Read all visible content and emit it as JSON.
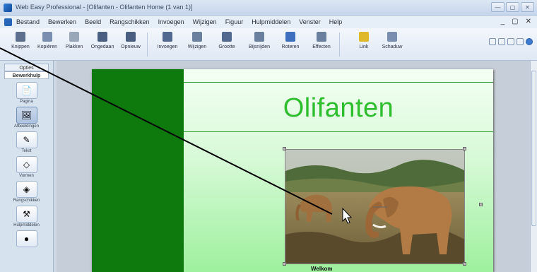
{
  "window": {
    "title": "Web Easy Professional - [Olifanten - Olifanten Home (1 van 1)]",
    "minimize": "—",
    "maximize": "▢",
    "close": "✕"
  },
  "menu": {
    "items": [
      "Bestand",
      "Bewerken",
      "Beeld",
      "Rangschikken",
      "Invoegen",
      "Wijzigen",
      "Figuur",
      "Hulpmiddelen",
      "Venster",
      "Help"
    ],
    "right": [
      "_",
      "▢",
      "✕"
    ]
  },
  "toolbar": {
    "buttons": [
      {
        "label": "Knippen",
        "color": "#5d6f8c"
      },
      {
        "label": "Kopiëren",
        "color": "#7a8fb0"
      },
      {
        "label": "Plakken",
        "color": "#9aa7b8"
      },
      {
        "label": "Ongedaan",
        "color": "#4a5e82"
      },
      {
        "label": "Opnieuw",
        "color": "#4a5e82"
      },
      {
        "label": "Invoegen",
        "color": "#52698f"
      },
      {
        "label": "Wijzigen",
        "color": "#6b7f9f"
      },
      {
        "label": "Grootte",
        "color": "#52698f"
      },
      {
        "label": "Bijsnijden",
        "color": "#6b7f9f"
      },
      {
        "label": "Roteren",
        "color": "#3e6fbf"
      },
      {
        "label": "Effecten",
        "color": "#6b7f9f"
      },
      {
        "label": "Link",
        "color": "#e0b92a"
      },
      {
        "label": "Schaduw",
        "color": "#7a8fb0"
      }
    ]
  },
  "panel": {
    "tabs": [
      "Opties",
      "Bewerkhulp"
    ],
    "buttons": [
      {
        "label": "Pagina",
        "icon": "📄"
      },
      {
        "label": "Afbeeldingen",
        "icon": "🖼"
      },
      {
        "label": "Tekst",
        "icon": "✎"
      },
      {
        "label": "Vormen",
        "icon": "◇"
      },
      {
        "label": "Rangschikken",
        "icon": "◈"
      },
      {
        "label": "Hulpmiddelen",
        "icon": "⚒"
      },
      {
        "label": "",
        "icon": "●"
      }
    ]
  },
  "page": {
    "title": "Olifanten",
    "caption": "Welkom",
    "sidebar_color": "#0e7a0e",
    "title_color": "#2dbd2d"
  }
}
